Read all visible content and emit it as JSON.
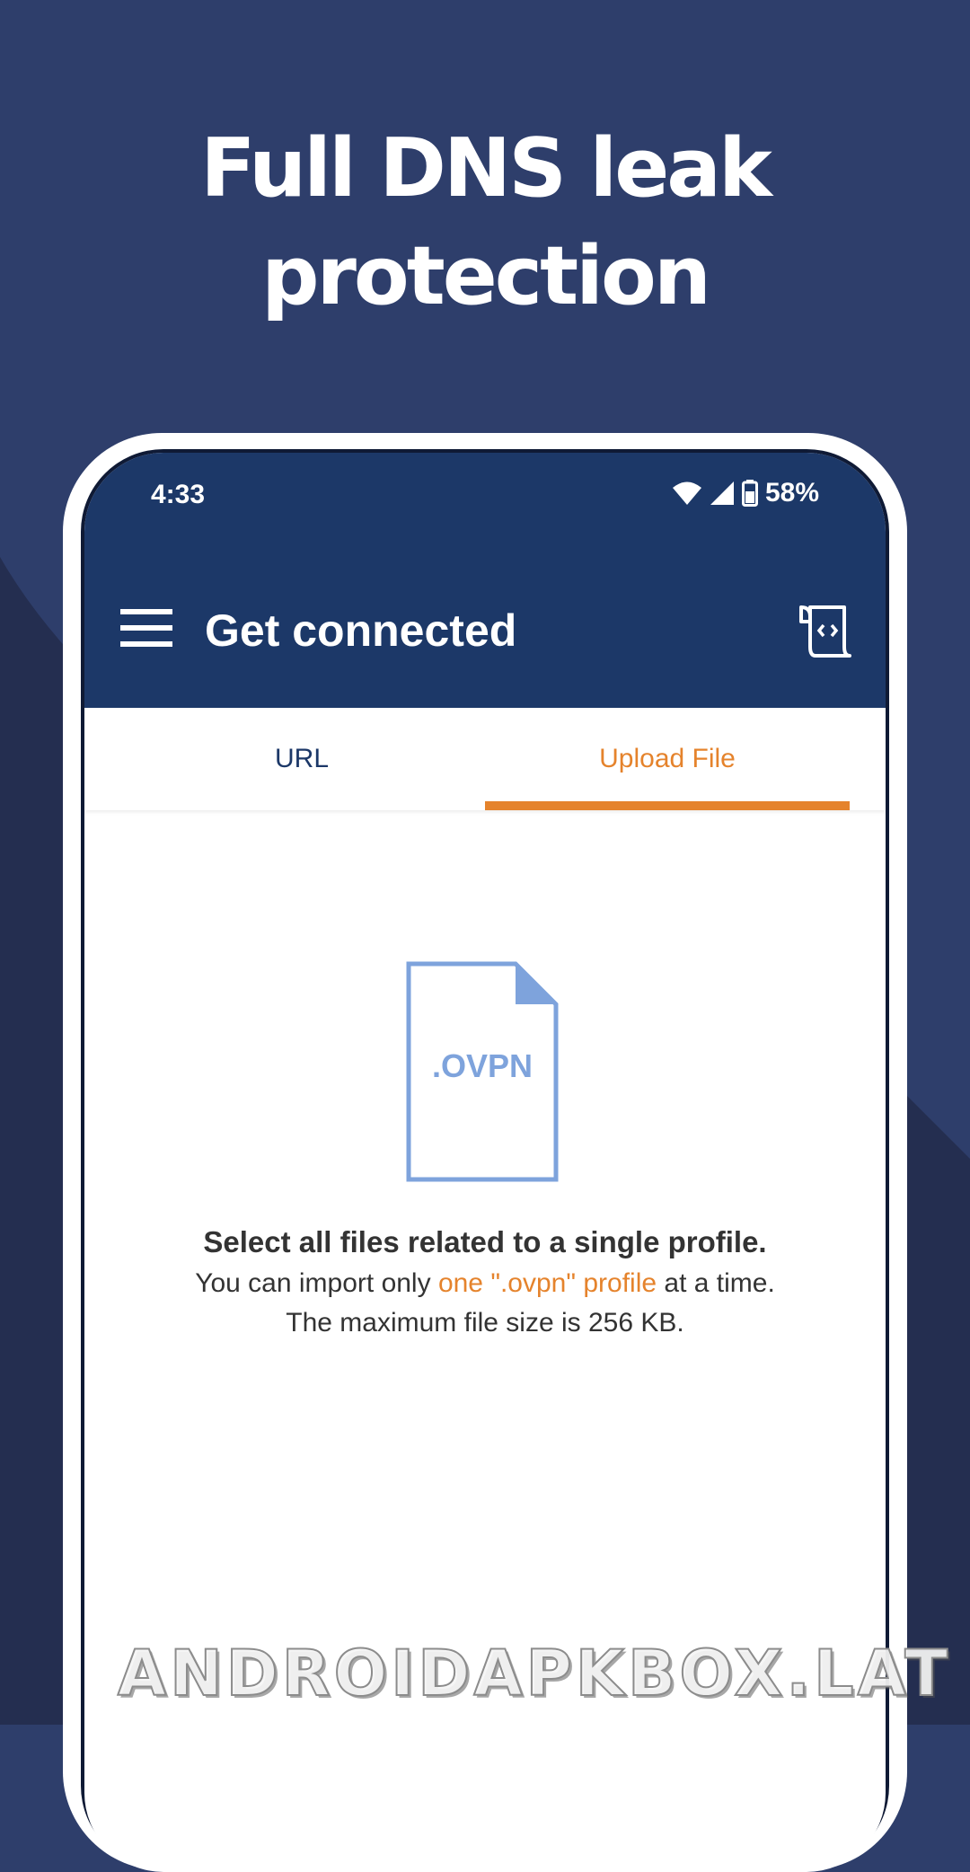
{
  "headline": {
    "line1": "Full DNS leak",
    "line2": "protection"
  },
  "status_bar": {
    "time": "4:33",
    "battery": "58%"
  },
  "app_bar": {
    "title": "Get connected",
    "menu_icon": "hamburger-menu-icon",
    "action_icon": "script-file-icon"
  },
  "tabs": [
    {
      "label": "URL",
      "selected": false
    },
    {
      "label": "Upload File",
      "selected": true
    }
  ],
  "upload": {
    "file_icon_label": ".OVPN",
    "title": "Select all files related to a single profile.",
    "line1_prefix": "You can import only ",
    "line1_accent": "one \".ovpn\" profile",
    "line1_suffix": " at a time.",
    "line2": "The maximum file size is 256 KB."
  },
  "watermark": "ANDROIDAPKBOX.LAT",
  "colors": {
    "background": "#2e3e6b",
    "background_dark": "#242e50",
    "app_bar": "#1c3868",
    "accent": "#e5832c",
    "file_icon": "#7ea3dc",
    "text": "#333333"
  }
}
